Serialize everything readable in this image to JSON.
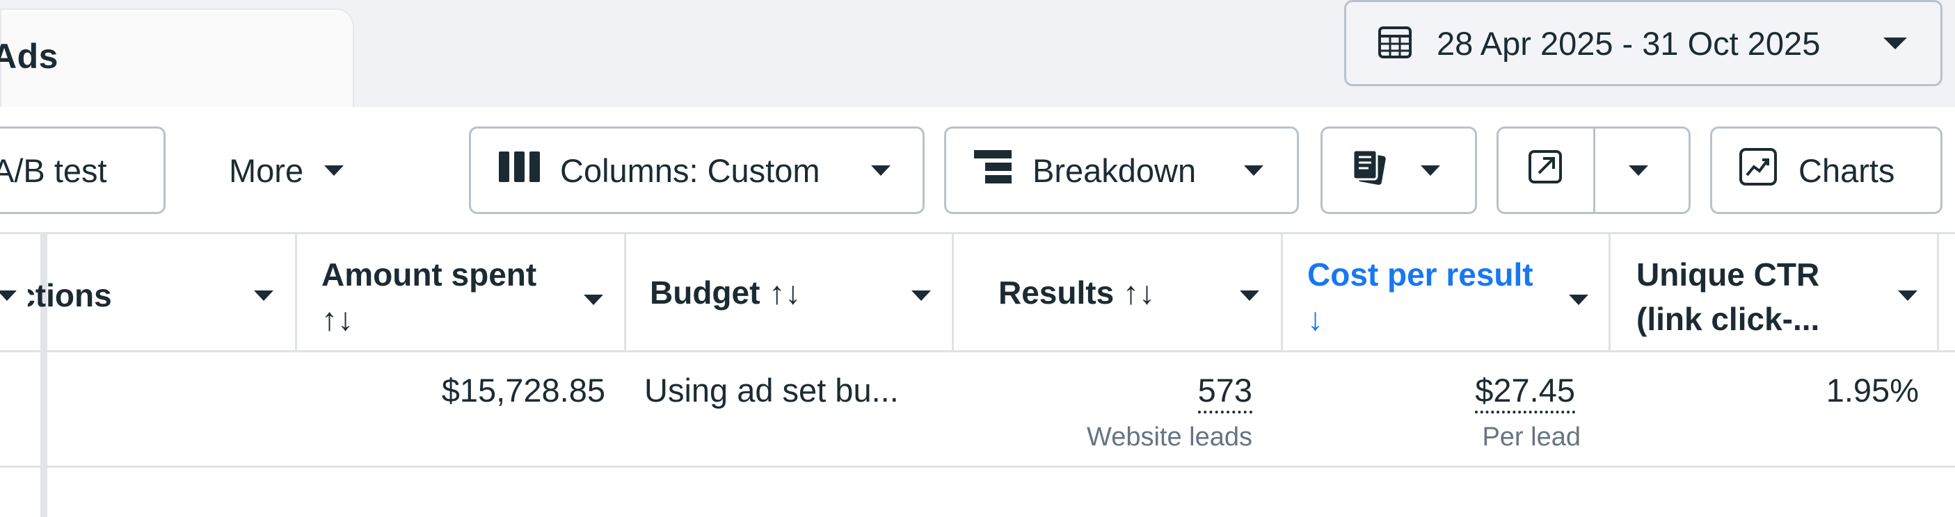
{
  "tabs": {
    "ads_label": "Ads"
  },
  "date_range": {
    "label": "28 Apr 2025 - 31 Oct 2025"
  },
  "toolbar": {
    "ab_test_label": "A/B test",
    "more_label": "More",
    "columns_label": "Columns: Custom",
    "breakdown_label": "Breakdown",
    "charts_label": "Charts"
  },
  "table": {
    "columns": {
      "actions": "Actions",
      "amount_spent": "Amount spent",
      "amount_spent_sort": "↑↓",
      "budget": "Budget ↑↓",
      "results": "Results ↑↓",
      "cost_per_result": "Cost per result",
      "cost_per_result_sort": "↓",
      "unique_ctr_line1": "Unique CTR",
      "unique_ctr_line2": "(link click-..."
    },
    "row": {
      "amount_spent": "$15,728.85",
      "budget": "Using ad set bu...",
      "results": "573",
      "results_sub": "Website leads",
      "cost_per_result": "$27.45",
      "cost_per_result_sub": "Per lead",
      "unique_ctr": "1.95%"
    }
  },
  "colors": {
    "accent": "#1877f2",
    "border": "#b9c2cc",
    "text": "#1c2b33",
    "muted": "#677481"
  },
  "icons": [
    "calendar-icon",
    "columns-icon",
    "breakdown-icon",
    "reports-icon",
    "export-icon",
    "charts-icon",
    "chevron-down-icon"
  ]
}
